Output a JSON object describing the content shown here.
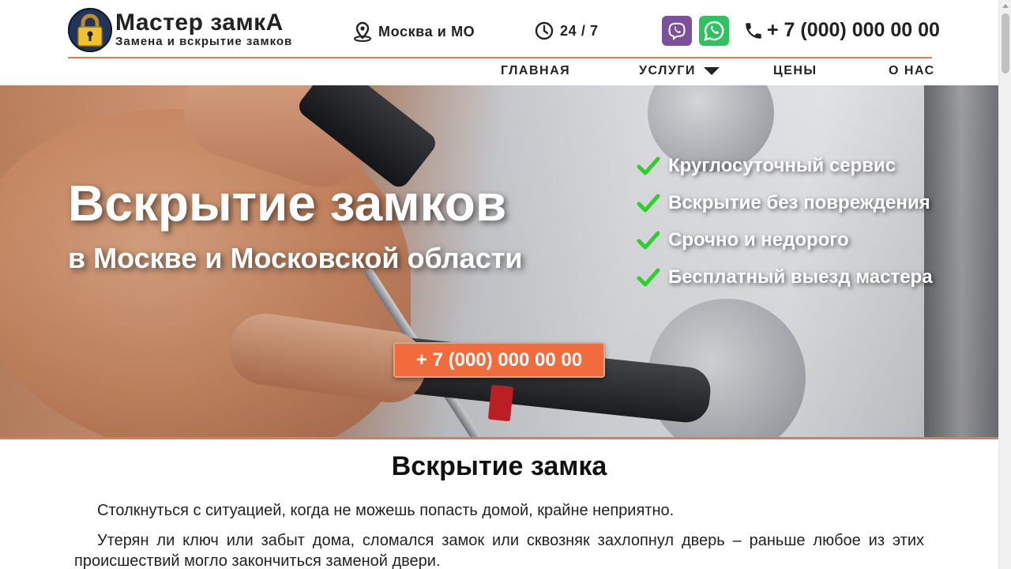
{
  "header": {
    "logo_title": "Мастер замкА",
    "logo_subtitle": "Замена и вскрытие замков",
    "location": "Москва и МО",
    "hours": "24 / 7",
    "phone": "+ 7 (000) 000 00 00",
    "messengers": [
      "viber-icon",
      "whatsapp-icon"
    ]
  },
  "nav": {
    "home": "ГЛАВНАЯ",
    "services": "УСЛУГИ",
    "prices": "ЦЕНЫ",
    "about": "О НАС"
  },
  "hero": {
    "title": "Вскрытие замков",
    "subtitle": "в Москве и Московской области",
    "features": [
      "Круглосуточный сервис",
      "Вскрытие без повреждения",
      "Срочно и недорого",
      "Бесплатный выезд мастера"
    ],
    "cta_phone": "+ 7 (000) 000 00 00"
  },
  "content": {
    "title": "Вскрытие замка",
    "paragraph1": "Столкнуться с ситуацией, когда не можешь попасть домой, крайне неприятно.",
    "paragraph2": "Утерян ли ключ или забыт дома, сломался замок или сквозняк захлопнул дверь – раньше любое из этих происшествий могло закончиться заменой двери."
  },
  "colors": {
    "accent": "#f26b3c",
    "divider": "#e07a52",
    "viber": "#7b519d",
    "whatsapp": "#2ec35f",
    "check": "#2fcf2a",
    "logo_bg": "#21345a"
  }
}
